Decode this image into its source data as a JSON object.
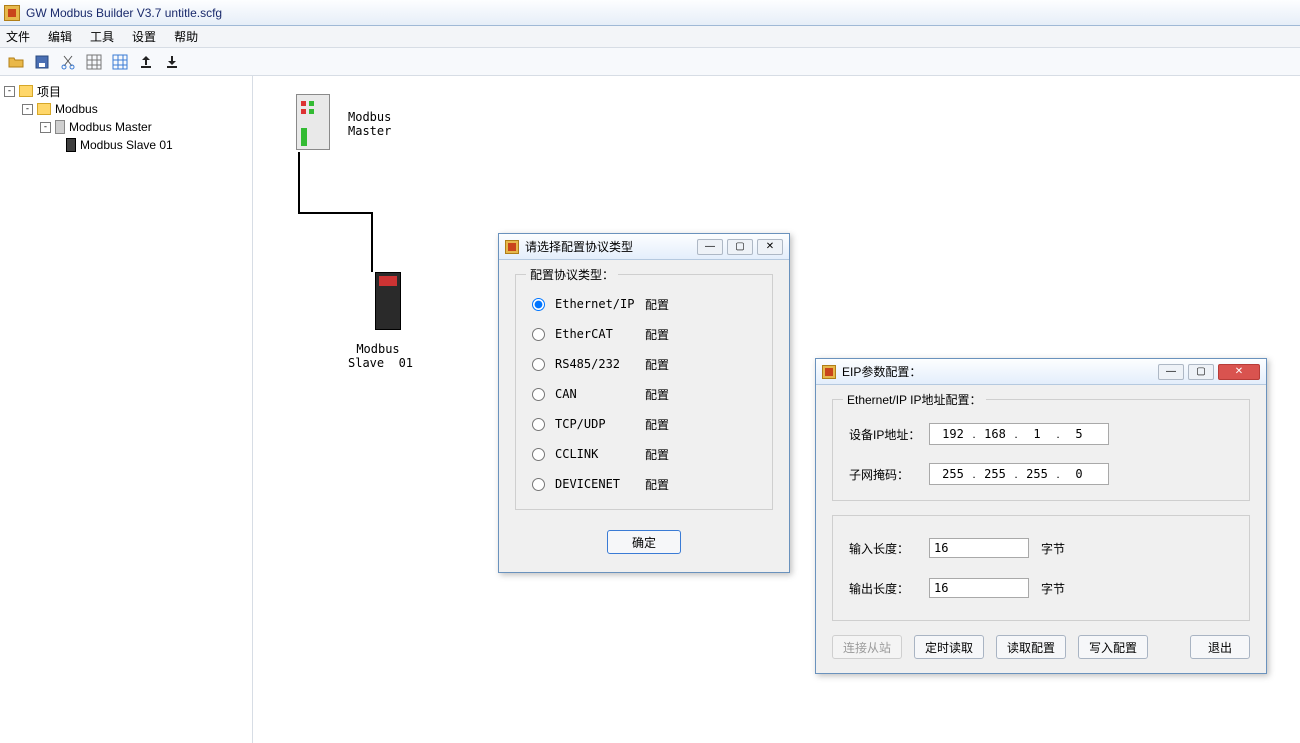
{
  "window": {
    "title": "GW Modbus Builder V3.7   untitle.scfg"
  },
  "menu": {
    "file": "文件",
    "edit": "编辑",
    "tool": "工具",
    "settings": "设置",
    "help": "帮助"
  },
  "toolbar_icons": [
    "open-icon",
    "save-icon",
    "cut-icon",
    "grid1-icon",
    "grid2-icon",
    "upload-icon",
    "download-icon"
  ],
  "tree": {
    "root": "项目",
    "modbus": "Modbus",
    "master": "Modbus Master",
    "slave": "Modbus Slave  01"
  },
  "canvas": {
    "master_label": "Modbus\nMaster",
    "slave_label": "Modbus\nSlave  01"
  },
  "protocol_dialog": {
    "title": "请选择配置协议类型",
    "group_title": "配置协议类型：",
    "options": [
      {
        "name": "Ethernet/IP",
        "suffix": "配置",
        "checked": true
      },
      {
        "name": "EtherCAT",
        "suffix": "配置",
        "checked": false
      },
      {
        "name": "RS485/232",
        "suffix": "配置",
        "checked": false
      },
      {
        "name": "CAN",
        "suffix": "配置",
        "checked": false
      },
      {
        "name": "TCP/UDP",
        "suffix": "配置",
        "checked": false
      },
      {
        "name": "CCLINK",
        "suffix": "配置",
        "checked": false
      },
      {
        "name": "DEVICENET",
        "suffix": "配置",
        "checked": false
      }
    ],
    "ok": "确定"
  },
  "eip_dialog": {
    "title": "EIP参数配置：",
    "group_title": "Ethernet/IP IP地址配置：",
    "ip_label": "设备IP地址：",
    "ip": [
      "192",
      "168",
      "1",
      "5"
    ],
    "mask_label": "子网掩码：",
    "mask": [
      "255",
      "255",
      "255",
      "0"
    ],
    "in_len_label": "输入长度：",
    "in_len_value": "16",
    "out_len_label": "输出长度：",
    "out_len_value": "16",
    "unit": "字节",
    "btn_connect": "连接从站",
    "btn_timed_read": "定时读取",
    "btn_read": "读取配置",
    "btn_write": "写入配置",
    "btn_exit": "退出"
  }
}
